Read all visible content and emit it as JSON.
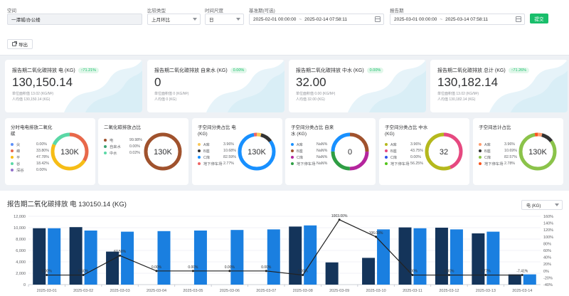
{
  "filters": {
    "space_label": "空间",
    "space_value": "一潭城/办公楼",
    "compare_label": "比较类型",
    "compare_value": "上月环比",
    "time_label": "时间尺度",
    "time_value": "日",
    "base_label": "基准期(可选)",
    "base_start": "2025-02-01 00:00:00",
    "base_end": "2025-02-14 07:58:11",
    "report_label": "报告期",
    "report_start": "2025-03-01 00:00:00",
    "report_end": "2025-03-14 07:58:11",
    "range_sep": "~",
    "submit_label": "提交",
    "export_label": "导出"
  },
  "kpis": [
    {
      "title": "报告期二氧化碳排放 电 (KG)",
      "badge": "↑71.21%",
      "value": "130,150.14",
      "sub1": "单位面积值 13.02 (KG/M²)",
      "sub2": "人均值 130,150.14 (KG)"
    },
    {
      "title": "报告期二氧化碳排放 自来水 (KG)",
      "badge": "0.00%",
      "value": "0",
      "sub1": "单位面积值 0 (KG/M²)",
      "sub2": "人均值 0 (KG)"
    },
    {
      "title": "报告期二氧化碳排放 中水 (KG)",
      "badge": "0.00%",
      "value": "32.00",
      "sub1": "单位面积值 0.00 (KG/M²)",
      "sub2": "人均值 32.00 (KG)"
    },
    {
      "title": "报告期二氧化碳排放 总计 (KG)",
      "badge": "↑71.26%",
      "value": "130,182.14",
      "sub1": "单位面积值 13.02 (KG/M²)",
      "sub2": "人均值 130,182.14 (KG)"
    }
  ],
  "pies": [
    {
      "title": "分时电电排放二氧化碳",
      "center": "130K",
      "legend": [
        {
          "name": "尖",
          "value": "0.00%",
          "color": "#5b8ff9"
        },
        {
          "name": "峰",
          "value": "33.80%",
          "color": "#e8684a"
        },
        {
          "name": "平",
          "value": "47.78%",
          "color": "#f6bd16"
        },
        {
          "name": "谷",
          "value": "18.42%",
          "color": "#5ad8a6"
        },
        {
          "name": "深谷",
          "value": "0.00%",
          "color": "#9270ca"
        }
      ],
      "segments": [
        {
          "value": 33.8,
          "color": "#e8684a"
        },
        {
          "value": 47.78,
          "color": "#f6bd16"
        },
        {
          "value": 18.42,
          "color": "#5ad8a6"
        }
      ]
    },
    {
      "title": "二氧化碳排放占比",
      "center": "130K",
      "legend": [
        {
          "name": "电",
          "value": "99.98%",
          "color": "#a0522d"
        },
        {
          "name": "自来水",
          "value": "0.00%",
          "color": "#3ba272"
        },
        {
          "name": "中水",
          "value": "0.02%",
          "color": "#5ad8a6"
        }
      ],
      "segments": [
        {
          "value": 99.98,
          "color": "#a0522d"
        },
        {
          "value": 0.02,
          "color": "#5ad8a6"
        }
      ]
    },
    {
      "title": "子空间分类占比 电 (KG)",
      "center": "130K",
      "legend": [
        {
          "name": "A库",
          "value": "3.96%",
          "color": "#fac858"
        },
        {
          "name": "B座",
          "value": "10.68%",
          "color": "#333333"
        },
        {
          "name": "C库",
          "value": "82.59%",
          "color": "#1890ff"
        },
        {
          "name": "地下停车场",
          "value": "2.77%",
          "color": "#ee6666"
        }
      ],
      "segments": [
        {
          "value": 3.96,
          "color": "#fac858"
        },
        {
          "value": 10.68,
          "color": "#333333"
        },
        {
          "value": 82.59,
          "color": "#1890ff"
        },
        {
          "value": 2.77,
          "color": "#ee6666"
        }
      ]
    },
    {
      "title": "子空间分类占比 自来水 (KG)",
      "center": "0",
      "legend": [
        {
          "name": "A库",
          "value": "NaN%",
          "color": "#1890ff"
        },
        {
          "name": "B座",
          "value": "NaN%",
          "color": "#a0522d"
        },
        {
          "name": "C库",
          "value": "NaN%",
          "color": "#b5259d"
        },
        {
          "name": "地下停车场",
          "value": "NaN%",
          "color": "#2f9e44"
        }
      ],
      "segments": [
        {
          "value": 25,
          "color": "#a0522d"
        },
        {
          "value": 25,
          "color": "#b5259d"
        },
        {
          "value": 25,
          "color": "#2f9e44"
        },
        {
          "value": 25,
          "color": "#1890ff"
        }
      ]
    },
    {
      "title": "子空间分类占比 中水 (KG)",
      "center": "32",
      "legend": [
        {
          "name": "A库",
          "value": "3.96%",
          "color": "#b5b81c"
        },
        {
          "name": "B座",
          "value": "43.75%",
          "color": "#e64980"
        },
        {
          "name": "C库",
          "value": "0.00%",
          "color": "#2f54eb"
        },
        {
          "name": "地下停车场",
          "value": "56.25%",
          "color": "#52c41a"
        }
      ],
      "segments": [
        {
          "value": 43.75,
          "color": "#e64980"
        },
        {
          "value": 56.25,
          "color": "#b5b81c"
        }
      ]
    },
    {
      "title": "子空间总计占比",
      "center": "130K",
      "legend": [
        {
          "name": "A库",
          "value": "3.96%",
          "color": "#ff9c6e"
        },
        {
          "name": "B座",
          "value": "10.69%",
          "color": "#333333"
        },
        {
          "name": "C库",
          "value": "82.57%",
          "color": "#8bc34a"
        },
        {
          "name": "地下停车场",
          "value": "2.78%",
          "color": "#fa541c"
        }
      ],
      "segments": [
        {
          "value": 3.96,
          "color": "#ff9c6e"
        },
        {
          "value": 10.69,
          "color": "#333333"
        },
        {
          "value": 82.57,
          "color": "#8bc34a"
        },
        {
          "value": 2.78,
          "color": "#fa541c"
        }
      ]
    }
  ],
  "chart": {
    "title": "报告期二氧化碳排放 电 130150.14 (KG)",
    "select_value": "电 (KG)"
  },
  "chart_data": {
    "type": "bar",
    "categories": [
      "2025-03-01",
      "2025-03-02",
      "2025-03-03",
      "2025-03-04",
      "2025-03-05",
      "2025-03-06",
      "2025-03-07",
      "2025-03-08",
      "2025-03-09",
      "2025-03-10",
      "2025-03-11",
      "2025-03-12",
      "2025-03-13",
      "2025-03-14"
    ],
    "series": [
      {
        "type": "bar",
        "color": "#14345a",
        "values": [
          9900,
          10100,
          5800,
          0,
          0,
          0,
          0,
          10200,
          3900,
          4700,
          10050,
          10000,
          9000,
          1800
        ]
      },
      {
        "type": "bar",
        "color": "#1a7fe0",
        "values": [
          9900,
          9500,
          9300,
          9400,
          9500,
          9600,
          9700,
          10400,
          0,
          9700,
          9900,
          9700,
          9300,
          1800
        ]
      },
      {
        "type": "line",
        "axis": "right",
        "color": "#222222",
        "values": [
          -12.0,
          -12.0,
          45.0,
          0.0,
          0.0,
          0.0,
          0.0,
          -12.0,
          150.0,
          100.0,
          -12.0,
          -12.0,
          -12.0,
          -12.0
        ],
        "labels": [
          "0.00%",
          "6.50%",
          "67.50%",
          "0.00%",
          "0.00%",
          "0.00%",
          "0.00%",
          "0.00%",
          "1003.00%",
          "106.00%",
          "0.00%",
          "0.00%",
          "8.77%",
          "-7.41%"
        ]
      }
    ],
    "y_left": {
      "min": 0,
      "max": 12000,
      "ticks": [
        "0",
        "2,000",
        "4,000",
        "6,000",
        "8,000",
        "10,000",
        "12,000"
      ]
    },
    "y_right": {
      "min": -40,
      "max": 160,
      "ticks": [
        "-40%",
        "-20%",
        "0%",
        "20%",
        "40%",
        "60%",
        "80%",
        "100%",
        "120%",
        "140%",
        "160%"
      ]
    },
    "grid": true
  }
}
